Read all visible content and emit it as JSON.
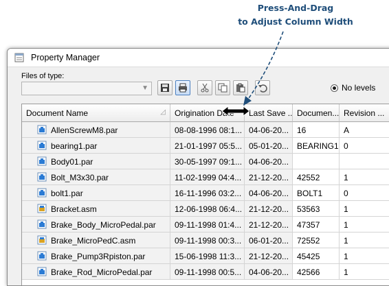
{
  "callout": {
    "line1": "Press-And-Drag",
    "line2": "to Adjust Column Width"
  },
  "window": {
    "title": "Property Manager"
  },
  "toolbar": {
    "files_of_type_label": "Files of type:",
    "files_of_type_value": "",
    "radio_label": "No levels",
    "buttons": [
      "save-icon",
      "print-icon",
      "cut-icon",
      "copy-icon",
      "paste-icon",
      "undo-icon"
    ]
  },
  "grid": {
    "columns": [
      "Document Name",
      "Origination Date",
      "Last Save ...",
      "Documen...",
      "Revision ..."
    ],
    "rows": [
      {
        "type": "part",
        "name": "AllenScrewM8.par",
        "orig": "08-08-1996 08:1...",
        "save": "04-06-20...",
        "doc": "16",
        "rev": "A"
      },
      {
        "type": "part",
        "name": "bearing1.par",
        "orig": "21-01-1997 05:5...",
        "save": "05-01-20...",
        "doc": "BEARING1",
        "rev": "0"
      },
      {
        "type": "part",
        "name": "Body01.par",
        "orig": "30-05-1997 09:1...",
        "save": "04-06-20...",
        "doc": "",
        "rev": ""
      },
      {
        "type": "part",
        "name": "Bolt_M3x30.par",
        "orig": "11-02-1999 04:4...",
        "save": "21-12-20...",
        "doc": "42552",
        "rev": "1"
      },
      {
        "type": "part",
        "name": "bolt1.par",
        "orig": "16-11-1996 03:2...",
        "save": "04-06-20...",
        "doc": "BOLT1",
        "rev": "0"
      },
      {
        "type": "asm",
        "name": "Bracket.asm",
        "orig": "12-06-1998 06:4...",
        "save": "21-12-20...",
        "doc": "53563",
        "rev": "1"
      },
      {
        "type": "part",
        "name": "Brake_Body_MicroPedal.par",
        "orig": "09-11-1998 01:4...",
        "save": "21-12-20...",
        "doc": "47357",
        "rev": "1"
      },
      {
        "type": "asm",
        "name": "Brake_MicroPedC.asm",
        "orig": "09-11-1998 00:3...",
        "save": "06-01-20...",
        "doc": "72552",
        "rev": "1"
      },
      {
        "type": "part",
        "name": "Brake_Pump3Rpiston.par",
        "orig": "15-06-1998 11:3...",
        "save": "21-12-20...",
        "doc": "45425",
        "rev": "1"
      },
      {
        "type": "part",
        "name": "Brake_Rod_MicroPedal.par",
        "orig": "09-11-1998 00:5...",
        "save": "04-06-20...",
        "doc": "42566",
        "rev": "1"
      }
    ]
  },
  "colors": {
    "callout": "#1f4e7a",
    "part_icon": "#2b7bd4",
    "asm_icon": "#d9a324"
  }
}
